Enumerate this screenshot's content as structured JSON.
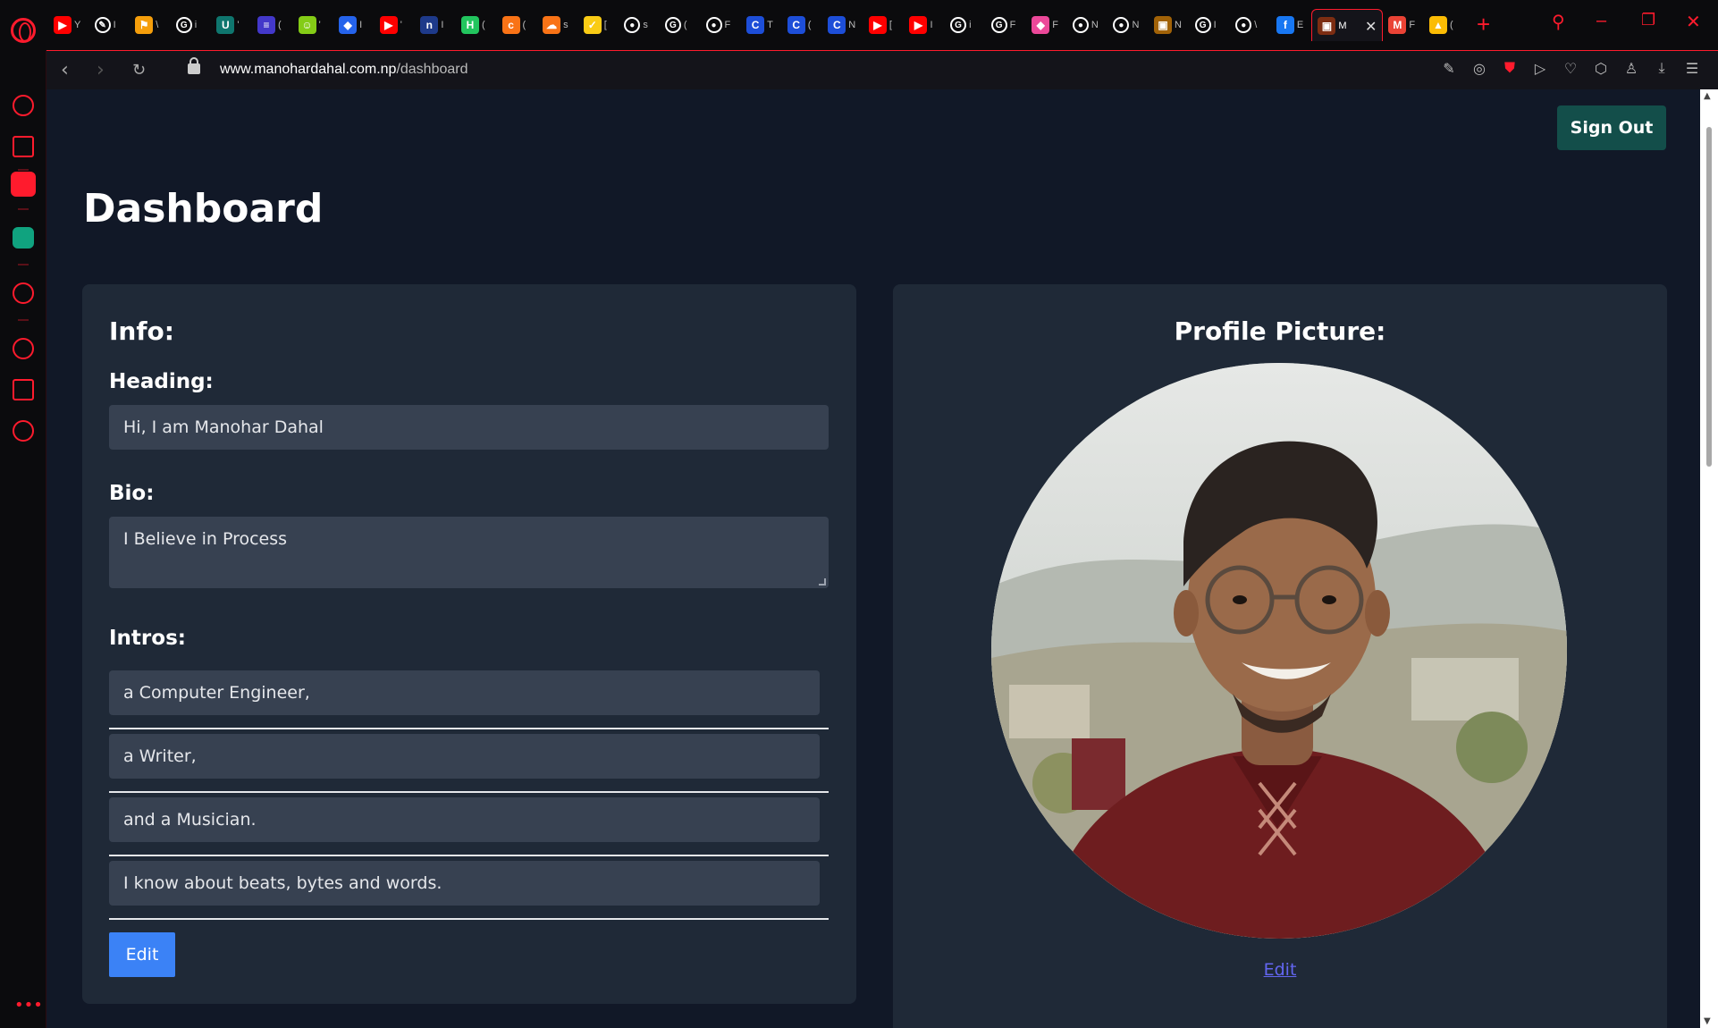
{
  "browser": {
    "tabs": [
      {
        "color": "#ff0000",
        "glyph": "▶",
        "label": "Y"
      },
      {
        "color": "#ffffff",
        "glyph": "✎",
        "label": "I"
      },
      {
        "color": "#f59e0b",
        "glyph": "⚑",
        "label": "\\"
      },
      {
        "color": "#ffffff",
        "glyph": "G",
        "label": "i"
      },
      {
        "color": "#0f766e",
        "glyph": "U",
        "label": "'"
      },
      {
        "color": "#4338ca",
        "glyph": "≡",
        "label": "("
      },
      {
        "color": "#84cc16",
        "glyph": "☺",
        "label": "'"
      },
      {
        "color": "#2563eb",
        "glyph": "◆",
        "label": "I"
      },
      {
        "color": "#ff0000",
        "glyph": "▶",
        "label": "'"
      },
      {
        "color": "#1e3a8a",
        "glyph": "n",
        "label": "I"
      },
      {
        "color": "#22c55e",
        "glyph": "H",
        "label": "("
      },
      {
        "color": "#f97316",
        "glyph": "c",
        "label": "("
      },
      {
        "color": "#f97316",
        "glyph": "☁",
        "label": "s"
      },
      {
        "color": "#facc15",
        "glyph": "✓",
        "label": "["
      },
      {
        "color": "#ffffff",
        "glyph": "●",
        "label": "s"
      },
      {
        "color": "#ffffff",
        "glyph": "G",
        "label": "("
      },
      {
        "color": "#ffffff",
        "glyph": "●",
        "label": "F"
      },
      {
        "color": "#1d4ed8",
        "glyph": "C",
        "label": "T"
      },
      {
        "color": "#1d4ed8",
        "glyph": "C",
        "label": "("
      },
      {
        "color": "#1d4ed8",
        "glyph": "C",
        "label": "N"
      },
      {
        "color": "#ff0000",
        "glyph": "▶",
        "label": "["
      },
      {
        "color": "#ff0000",
        "glyph": "▶",
        "label": "I"
      },
      {
        "color": "#ffffff",
        "glyph": "G",
        "label": "i"
      },
      {
        "color": "#ffffff",
        "glyph": "G",
        "label": "F"
      },
      {
        "color": "#ec4899",
        "glyph": "◆",
        "label": "F"
      },
      {
        "color": "#ffffff",
        "glyph": "●",
        "label": "N"
      },
      {
        "color": "#ffffff",
        "glyph": "●",
        "label": "N"
      },
      {
        "color": "#a16207",
        "glyph": "▣",
        "label": "N"
      },
      {
        "color": "#ffffff",
        "glyph": "G",
        "label": "I"
      },
      {
        "color": "#ffffff",
        "glyph": "●",
        "label": "\\"
      },
      {
        "color": "#1877f2",
        "glyph": "f",
        "label": "E"
      },
      {
        "color": "#7c2d12",
        "glyph": "▣",
        "label": "M",
        "active": true
      },
      {
        "color": "#ea4335",
        "glyph": "M",
        "label": "F"
      },
      {
        "color": "#fbbc04",
        "glyph": "▲",
        "label": "("
      }
    ],
    "url_domain": "www.manohardahal.com.np",
    "url_path": "/dashboard"
  },
  "page": {
    "signout_label": "Sign Out",
    "title": "Dashboard",
    "info": {
      "title": "Info:",
      "heading_label": "Heading:",
      "heading_value": "Hi, I am Manohar Dahal",
      "bio_label": "Bio:",
      "bio_value": "I Believe in Process",
      "intros_label": "Intros:",
      "intros": [
        "a Computer Engineer,",
        "a Writer,",
        "and a Musician.",
        "I know about beats, bytes and words."
      ],
      "edit_label": "Edit"
    },
    "picture": {
      "title": "Profile Picture:",
      "edit_label": "Edit"
    }
  },
  "colors": {
    "page_bg": "#111827",
    "card_bg": "#1f2937",
    "input_bg": "#374151",
    "signout_bg": "#134e4a",
    "edit_btn_bg": "#3b82f6",
    "link": "#6366f1",
    "browser_accent": "#ff1b2d"
  }
}
